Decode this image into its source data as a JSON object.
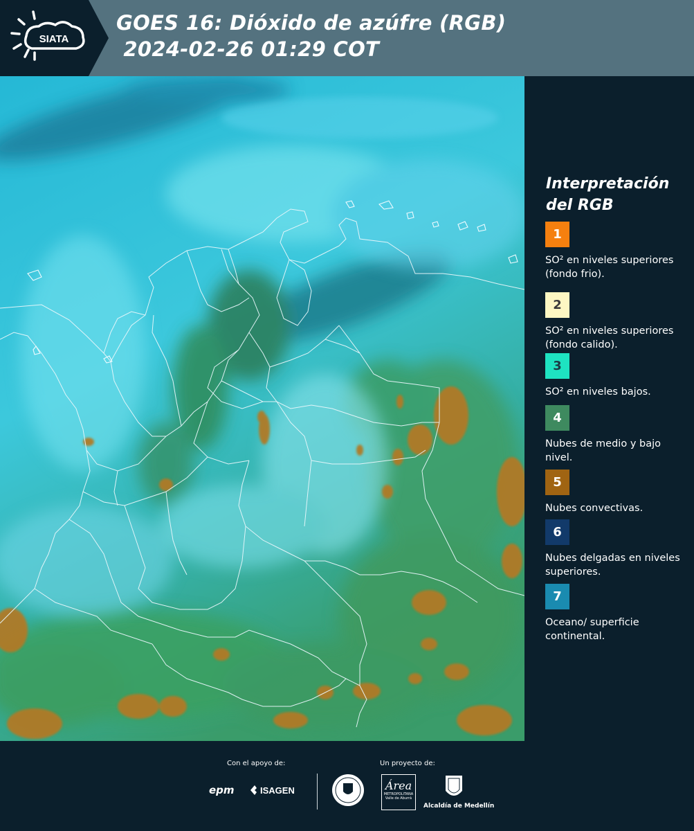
{
  "header": {
    "brand_text": "SIATA",
    "title_line1": "GOES 16: Dióxido de azúfre (RGB)",
    "title_line2": " 2024-02-26 01:29 COT",
    "bar_color": "#54727f",
    "logo_bg_color": "#0b1f2c"
  },
  "legend": {
    "title": "Interpretación del RGB",
    "items": [
      {
        "num": "1",
        "color": "#f5800f",
        "num_color": "#ffffff",
        "label": "SO² en niveles superiores (fondo frio)."
      },
      {
        "num": "2",
        "color": "#fdf7c3",
        "num_color": "#3a3a3a",
        "label": "SO² en niveles superiores (fondo calido)."
      },
      {
        "num": "3",
        "color": "#1ee3c1",
        "num_color": "#1b3b44",
        "label": "SO² en niveles bajos."
      },
      {
        "num": "4",
        "color": "#3e8a5f",
        "num_color": "#ffffff",
        "label": "Nubes de medio y bajo nivel."
      },
      {
        "num": "5",
        "color": "#a06412",
        "num_color": "#ffffff",
        "label": "Nubes convectivas."
      },
      {
        "num": "6",
        "color": "#123a6a",
        "num_color": "#ffffff",
        "label": "Nubes delgadas en niveles superiores."
      },
      {
        "num": "7",
        "color": "#1a8bb0",
        "num_color": "#ffffff",
        "label": "Oceano/ superficie continental."
      }
    ]
  },
  "footer": {
    "support_label": "Con el apoyo de:",
    "project_label": "Un proyecto de:",
    "sponsor_epm": "epm",
    "sponsor_isagen": "ISAGEN",
    "area_text": "Área",
    "area_sub": "METROPOLITANA",
    "area_sub2": "Valle de Aburrá",
    "alcaldia": "Alcaldía de Medellín"
  }
}
